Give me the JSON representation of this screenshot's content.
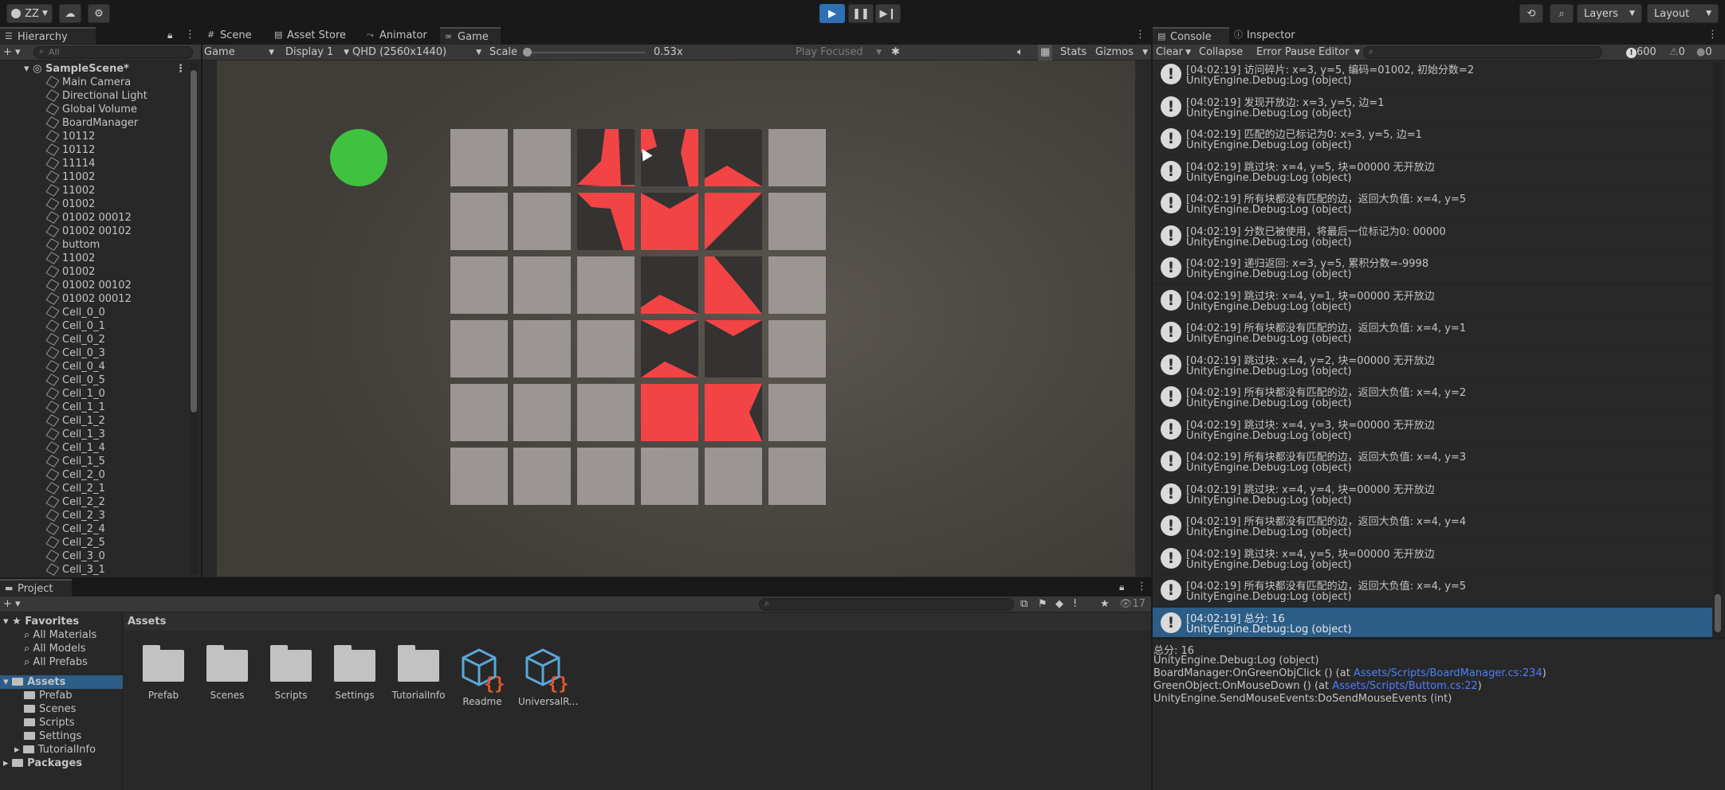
{
  "topbar": {
    "account": "ZZ",
    "layers_label": "Layers",
    "layout_label": "Layout"
  },
  "hierarchy": {
    "tab_label": "Hierarchy",
    "search_placeholder": "All",
    "scene_name": "SampleScene*",
    "items": [
      "Main Camera",
      "Directional Light",
      "Global Volume",
      "BoardManager",
      "10112",
      "10112",
      "11114",
      "11002",
      "11002",
      "01002",
      "01002 00012",
      "01002 00102",
      "buttom",
      "11002",
      "01002",
      "01002 00102",
      "01002 00012",
      "Cell_0_0",
      "Cell_0_1",
      "Cell_0_2",
      "Cell_0_3",
      "Cell_0_4",
      "Cell_0_5",
      "Cell_1_0",
      "Cell_1_1",
      "Cell_1_2",
      "Cell_1_3",
      "Cell_1_4",
      "Cell_1_5",
      "Cell_2_0",
      "Cell_2_1",
      "Cell_2_2",
      "Cell_2_3",
      "Cell_2_4",
      "Cell_2_5",
      "Cell_3_0",
      "Cell_3_1"
    ]
  },
  "scene_tabs": {
    "scene": "Scene",
    "asset_store": "Asset Store",
    "animator": "Animator",
    "game": "Game"
  },
  "game_toolbar": {
    "game_select": "Game",
    "display_select": "Display 1",
    "resolution_select": "QHD (2560x1440)",
    "scale_label": "Scale",
    "scale_value": "0.53x",
    "play_focused": "Play Focused",
    "stats": "Stats",
    "gizmos": "Gizmos"
  },
  "console": {
    "tab_label": "Console",
    "inspector_label": "Inspector",
    "clear": "Clear",
    "collapse": "Collapse",
    "error_pause": "Error Pause",
    "editor": "Editor",
    "count_log": "600",
    "count_warn": "0",
    "count_err": "0",
    "entries": [
      {
        "msg": "[04:02:19] 访问碎片: x=3, y=5, 编码=01002, 初始分数=2",
        "src": "UnityEngine.Debug:Log (object)"
      },
      {
        "msg": "[04:02:19] 发现开放边: x=3, y=5, 边=1",
        "src": "UnityEngine.Debug:Log (object)"
      },
      {
        "msg": "[04:02:19] 匹配的边已标记为0: x=3, y=5, 边=1",
        "src": "UnityEngine.Debug:Log (object)"
      },
      {
        "msg": "[04:02:19] 跳过块: x=4, y=5, 块=00000 无开放边",
        "src": "UnityEngine.Debug:Log (object)"
      },
      {
        "msg": "[04:02:19] 所有块都没有匹配的边，返回大负值: x=4, y=5",
        "src": "UnityEngine.Debug:Log (object)"
      },
      {
        "msg": "[04:02:19] 分数已被使用，将最后一位标记为0: 00000",
        "src": "UnityEngine.Debug:Log (object)"
      },
      {
        "msg": "[04:02:19] 递归返回: x=3, y=5, 累积分数=-9998",
        "src": "UnityEngine.Debug:Log (object)"
      },
      {
        "msg": "[04:02:19] 跳过块: x=4, y=1, 块=00000 无开放边",
        "src": "UnityEngine.Debug:Log (object)"
      },
      {
        "msg": "[04:02:19] 所有块都没有匹配的边，返回大负值: x=4, y=1",
        "src": "UnityEngine.Debug:Log (object)"
      },
      {
        "msg": "[04:02:19] 跳过块: x=4, y=2, 块=00000 无开放边",
        "src": "UnityEngine.Debug:Log (object)"
      },
      {
        "msg": "[04:02:19] 所有块都没有匹配的边，返回大负值: x=4, y=2",
        "src": "UnityEngine.Debug:Log (object)"
      },
      {
        "msg": "[04:02:19] 跳过块: x=4, y=3, 块=00000 无开放边",
        "src": "UnityEngine.Debug:Log (object)"
      },
      {
        "msg": "[04:02:19] 所有块都没有匹配的边，返回大负值: x=4, y=3",
        "src": "UnityEngine.Debug:Log (object)"
      },
      {
        "msg": "[04:02:19] 跳过块: x=4, y=4, 块=00000 无开放边",
        "src": "UnityEngine.Debug:Log (object)"
      },
      {
        "msg": "[04:02:19] 所有块都没有匹配的边，返回大负值: x=4, y=4",
        "src": "UnityEngine.Debug:Log (object)"
      },
      {
        "msg": "[04:02:19] 跳过块: x=4, y=5, 块=00000 无开放边",
        "src": "UnityEngine.Debug:Log (object)"
      },
      {
        "msg": "[04:02:19] 所有块都没有匹配的边，返回大负值: x=4, y=5",
        "src": "UnityEngine.Debug:Log (object)"
      },
      {
        "msg": "[04:02:19] 总分: 16",
        "src": "UnityEngine.Debug:Log (object)"
      }
    ],
    "detail": {
      "line1": "总分: 16",
      "line2": "UnityEngine.Debug:Log (object)",
      "line3_pre": "BoardManager:OnGreenObjClick () (at ",
      "line3_link": "Assets/Scripts/BoardManager.cs:234",
      "line3_post": ")",
      "line4_pre": "GreenObject:OnMouseDown () (at ",
      "line4_link": "Assets/Scripts/Buttom.cs:22",
      "line4_post": ")",
      "line5": "UnityEngine.SendMouseEvents:DoSendMouseEvents (int)"
    }
  },
  "project": {
    "tab_label": "Project",
    "favorites": "Favorites",
    "fav_items": [
      "All Materials",
      "All Models",
      "All Prefabs"
    ],
    "assets_root": "Assets",
    "asset_folders": [
      "Prefab",
      "Scenes",
      "Scripts",
      "Settings",
      "TutorialInfo"
    ],
    "packages": "Packages",
    "breadcrumb": "Assets",
    "hidden_count": "17",
    "grid_items": [
      "Prefab",
      "Scenes",
      "Scripts",
      "Settings",
      "TutorialInfo",
      "Readme",
      "UniversalR..."
    ]
  },
  "colors": {
    "accent_blue": "#2c5d87",
    "tile_red": "#f24444",
    "tile_light": "#9b9593",
    "green_button": "#3fc33f"
  }
}
